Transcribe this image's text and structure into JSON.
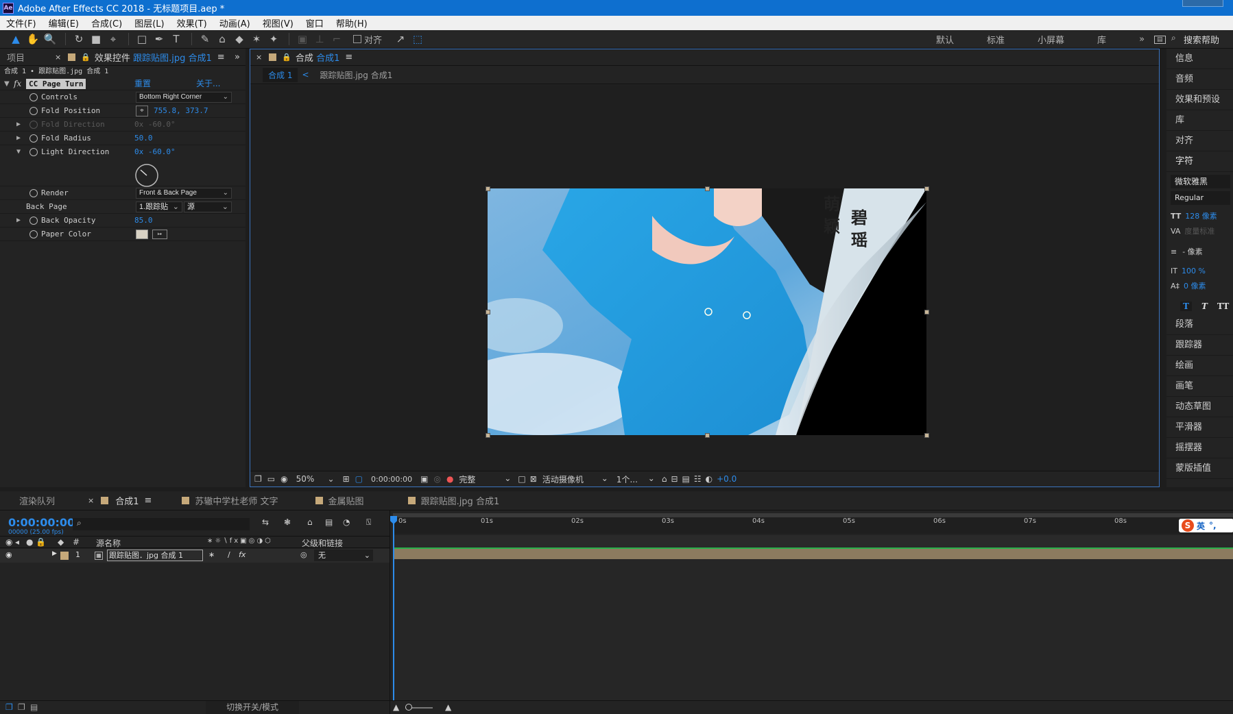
{
  "app": {
    "title": "Adobe After Effects CC 2018 - 无标题项目.aep *",
    "logo_text": "Ae"
  },
  "menu": [
    "文件(F)",
    "编辑(E)",
    "合成(C)",
    "图层(L)",
    "效果(T)",
    "动画(A)",
    "视图(V)",
    "窗口",
    "帮助(H)"
  ],
  "toolbar": {
    "align_label": "对齐",
    "workspaces": [
      "默认",
      "标准",
      "小屏幕",
      "库"
    ],
    "more": "»",
    "search_help": "搜索帮助"
  },
  "project_panel": {
    "tab_project": "项目",
    "tab_effect_prefix": "效果控件",
    "tab_effect_layer": "跟踪贴图.jpg 合成1",
    "breadcrumb": "合成 1 • 跟踪贴图.jpg 合成 1"
  },
  "effect": {
    "fx_label": "fx",
    "name": "CC Page Turn",
    "reset": "重置",
    "about": "关于...",
    "properties": [
      {
        "name": "Controls",
        "value": "Bottom Right Corner",
        "kind": "dropdown"
      },
      {
        "name": "Fold Position",
        "value": "755.8, 373.7",
        "kind": "point"
      },
      {
        "name": "Fold Direction",
        "value": "0x -60.0°",
        "kind": "value",
        "disabled": true
      },
      {
        "name": "Fold Radius",
        "value": "50.0",
        "kind": "value"
      },
      {
        "name": "Light Direction",
        "value": "0x -60.0°",
        "kind": "value"
      },
      {
        "name": "Render",
        "value": "Front & Back Page",
        "kind": "dropdown"
      },
      {
        "name": "Back Page",
        "value": "1.跟踪贴",
        "value2": "源",
        "kind": "dropdown2"
      },
      {
        "name": "Back Opacity",
        "value": "85.0",
        "kind": "value"
      },
      {
        "name": "Paper Color",
        "value": "#d8d2c4",
        "kind": "color"
      }
    ]
  },
  "composition": {
    "tab_prefix": "合成",
    "tab_name": "合成1",
    "crumb_active": "合成 1",
    "crumb_next": "跟踪贴图.jpg 合成1",
    "image_text_1": "碧 瑶",
    "image_text_2": "萌 颖",
    "zoom": "50%",
    "timecode": "0:00:00:00",
    "quality": "完整",
    "camera": "活动摄像机",
    "views": "1个...",
    "exposure": "+0.0"
  },
  "right_panel": {
    "items": [
      "信息",
      "音频",
      "效果和预设",
      "库",
      "对齐",
      "字符"
    ],
    "font": "微软雅黑",
    "style": "Regular",
    "font_size": "128 像素",
    "tracking": "度量标准",
    "leading": "- 像素",
    "vscale": "100 %",
    "baseline": "0 像素",
    "text_styles": [
      "T",
      "T",
      "TT"
    ],
    "items2": [
      "段落",
      "跟踪器",
      "绘画",
      "画笔",
      "动态草图",
      "平滑器",
      "摇摆器",
      "蒙版插值"
    ]
  },
  "timeline": {
    "tabs": [
      "渲染队列",
      "合成1",
      "苏辙中学杜老师 文字",
      "金属贴图",
      "跟踪贴图.jpg 合成1"
    ],
    "timecode": "0:00:00:00",
    "fps": "00000 (25.00 fps)",
    "col_source": "源名称",
    "col_parent": "父级和链接",
    "layer_num": "1",
    "layer_name": "跟踪贴图．jpg 合成 1",
    "parent_value": "无",
    "ticks": [
      "0s",
      "01s",
      "02s",
      "03s",
      "04s",
      "05s",
      "06s",
      "07s",
      "08s"
    ],
    "toggle_label": "切换开关/模式",
    "ime_label": "英"
  }
}
